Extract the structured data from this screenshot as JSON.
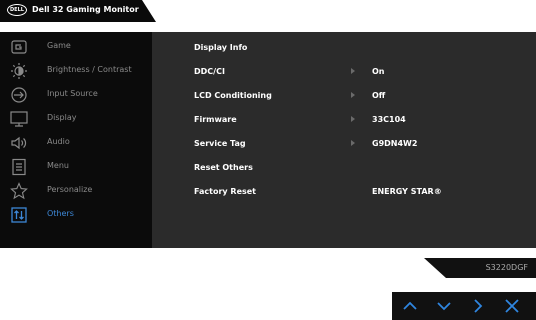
{
  "header": {
    "logo_text": "DELL",
    "title": "Dell 32 Gaming Monitor"
  },
  "menu": [
    {
      "label": "Game",
      "icon": "game-icon"
    },
    {
      "label": "Brightness / Contrast",
      "icon": "brightness-icon"
    },
    {
      "label": "Input Source",
      "icon": "input-source-icon"
    },
    {
      "label": "Display",
      "icon": "display-icon"
    },
    {
      "label": "Audio",
      "icon": "audio-icon"
    },
    {
      "label": "Menu",
      "icon": "menu-icon"
    },
    {
      "label": "Personalize",
      "icon": "star-icon"
    },
    {
      "label": "Others",
      "icon": "others-icon",
      "active": true
    }
  ],
  "settings": {
    "display_info": "Display Info",
    "ddc_ci": {
      "label": "DDC/CI",
      "value": "On"
    },
    "lcd_conditioning": {
      "label": "LCD Conditioning",
      "value": "Off"
    },
    "firmware": {
      "label": "Firmware",
      "value": "33C104"
    },
    "service_tag": {
      "label": "Service Tag",
      "value": "G9DN4W2"
    },
    "reset_others": "Reset Others",
    "factory_reset": {
      "label": "Factory Reset",
      "badge": "ENERGY STAR®"
    }
  },
  "model": "S3220DGF",
  "nav_buttons": [
    "up-arrow-icon",
    "down-arrow-icon",
    "right-arrow-icon",
    "close-icon"
  ],
  "colors": {
    "accent": "#3d87d6",
    "nav_icon": "#2f86e0"
  }
}
